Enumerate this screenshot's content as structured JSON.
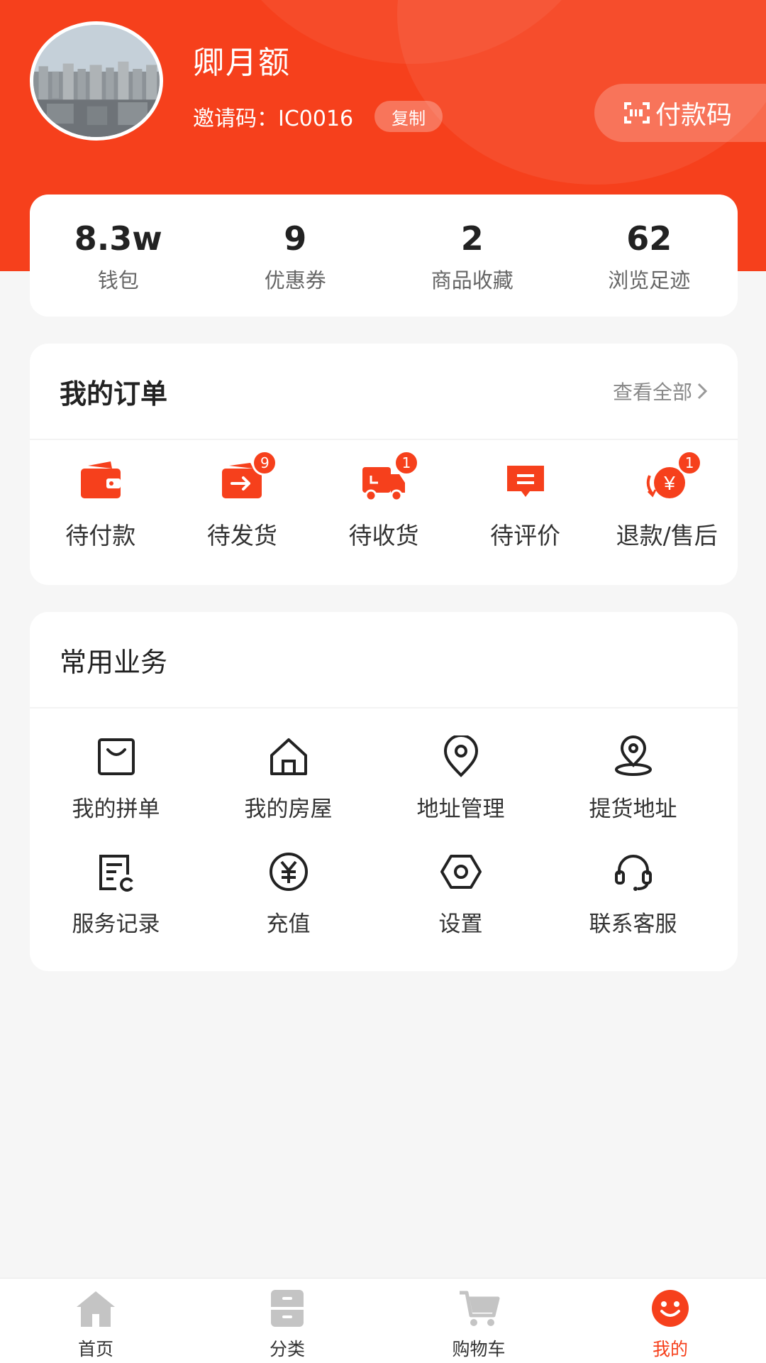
{
  "profile": {
    "name": "卿月额",
    "invite_code": "邀请码：IC0016",
    "copy_label": "复制",
    "pay_code_label": "付款码"
  },
  "stats": [
    {
      "value": "8.3w",
      "label": "钱包"
    },
    {
      "value": "9",
      "label": "优惠券"
    },
    {
      "value": "2",
      "label": "商品收藏"
    },
    {
      "value": "62",
      "label": "浏览足迹"
    }
  ],
  "orders": {
    "title": "我的订单",
    "view_all": "查看全部",
    "items": [
      {
        "label": "待付款",
        "icon": "wallet-icon",
        "badge": ""
      },
      {
        "label": "待发货",
        "icon": "card-arrow-icon",
        "badge": "9"
      },
      {
        "label": "待收货",
        "icon": "delivery-truck-icon",
        "badge": "1"
      },
      {
        "label": "待评价",
        "icon": "comment-icon",
        "badge": ""
      },
      {
        "label": "退款/售后",
        "icon": "refund-icon",
        "badge": "1"
      }
    ]
  },
  "services": {
    "title": "常用业务",
    "items": [
      {
        "label": "我的拼单",
        "icon": "shopping-bag-icon"
      },
      {
        "label": "我的房屋",
        "icon": "house-icon"
      },
      {
        "label": "地址管理",
        "icon": "location-pin-icon"
      },
      {
        "label": "提货地址",
        "icon": "pickup-location-icon"
      },
      {
        "label": "服务记录",
        "icon": "service-record-icon"
      },
      {
        "label": "充值",
        "icon": "yuan-coin-icon"
      },
      {
        "label": "设置",
        "icon": "settings-hex-icon"
      },
      {
        "label": "联系客服",
        "icon": "headset-icon"
      }
    ]
  },
  "tabbar": [
    {
      "label": "首页",
      "icon": "home-icon",
      "active": false
    },
    {
      "label": "分类",
      "icon": "category-icon",
      "active": false
    },
    {
      "label": "购物车",
      "icon": "cart-icon",
      "active": false
    },
    {
      "label": "我的",
      "icon": "smiley-icon",
      "active": true
    }
  ],
  "colors": {
    "accent": "#f6401c",
    "background": "#f6f6f6",
    "inactive_tab": "#c4c4c4"
  }
}
